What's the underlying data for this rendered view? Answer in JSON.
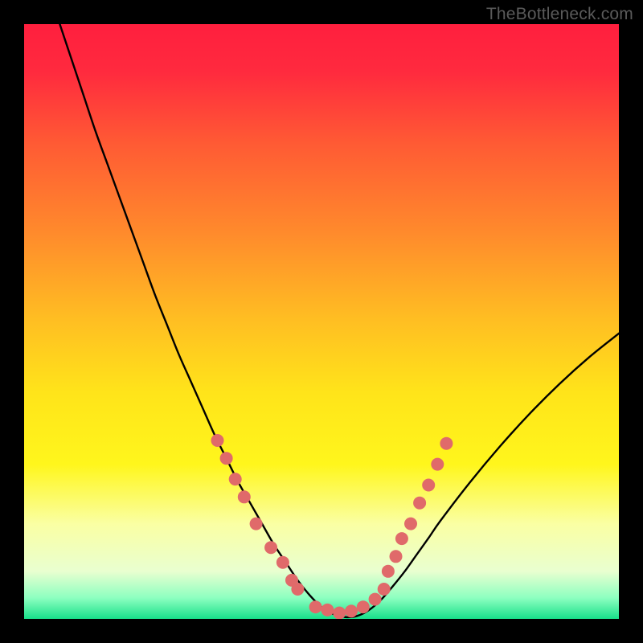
{
  "watermark": "TheBottleneck.com",
  "chart_data": {
    "type": "line",
    "title": "",
    "xlabel": "",
    "ylabel": "",
    "xlim": [
      0,
      100
    ],
    "ylim": [
      0,
      100
    ],
    "grid": false,
    "legend": false,
    "background_gradient_stops": [
      {
        "offset": 0,
        "color": "#ff1f3e"
      },
      {
        "offset": 0.08,
        "color": "#ff2a3e"
      },
      {
        "offset": 0.2,
        "color": "#ff5a34"
      },
      {
        "offset": 0.35,
        "color": "#ff8a2c"
      },
      {
        "offset": 0.5,
        "color": "#ffbf22"
      },
      {
        "offset": 0.62,
        "color": "#ffe41a"
      },
      {
        "offset": 0.74,
        "color": "#fff61c"
      },
      {
        "offset": 0.84,
        "color": "#faffa3"
      },
      {
        "offset": 0.92,
        "color": "#e9ffd0"
      },
      {
        "offset": 0.965,
        "color": "#8cffc0"
      },
      {
        "offset": 1.0,
        "color": "#18e08a"
      }
    ],
    "series": [
      {
        "name": "bottleneck-curve",
        "x": [
          6,
          8,
          10,
          12,
          14,
          16,
          18,
          20,
          22,
          24,
          26,
          28,
          30,
          32,
          34,
          36,
          38,
          40,
          42,
          44,
          46,
          48,
          50,
          52,
          54,
          56,
          58,
          60,
          62,
          64,
          66,
          68,
          70,
          75,
          80,
          85,
          90,
          95,
          100
        ],
        "y": [
          100,
          94,
          88,
          82,
          76.5,
          71,
          65.5,
          60,
          54.5,
          49.5,
          44.5,
          40,
          35.5,
          31,
          27,
          23,
          19.5,
          16,
          12.5,
          9.5,
          6.5,
          4,
          2,
          0.8,
          0.3,
          0.5,
          1.5,
          3.2,
          5.5,
          8,
          10.8,
          13.6,
          16.5,
          23,
          29,
          34.5,
          39.5,
          44,
          48
        ]
      }
    ],
    "annotations": {
      "markers": {
        "color": "#e06a6a",
        "radius_px": 8,
        "points_xy": [
          [
            32.5,
            30
          ],
          [
            34,
            27
          ],
          [
            35.5,
            23.5
          ],
          [
            37,
            20.5
          ],
          [
            39,
            16
          ],
          [
            41.5,
            12
          ],
          [
            43.5,
            9.5
          ],
          [
            45,
            6.5
          ],
          [
            46,
            5
          ],
          [
            49,
            2
          ],
          [
            51,
            1.5
          ],
          [
            53,
            1
          ],
          [
            55,
            1.3
          ],
          [
            57,
            2
          ],
          [
            59,
            3.3
          ],
          [
            60.5,
            5
          ],
          [
            61.2,
            8
          ],
          [
            62.5,
            10.5
          ],
          [
            63.5,
            13.5
          ],
          [
            65,
            16
          ],
          [
            66.5,
            19.5
          ],
          [
            68,
            22.5
          ],
          [
            69.5,
            26
          ],
          [
            71,
            29.5
          ]
        ]
      }
    }
  }
}
